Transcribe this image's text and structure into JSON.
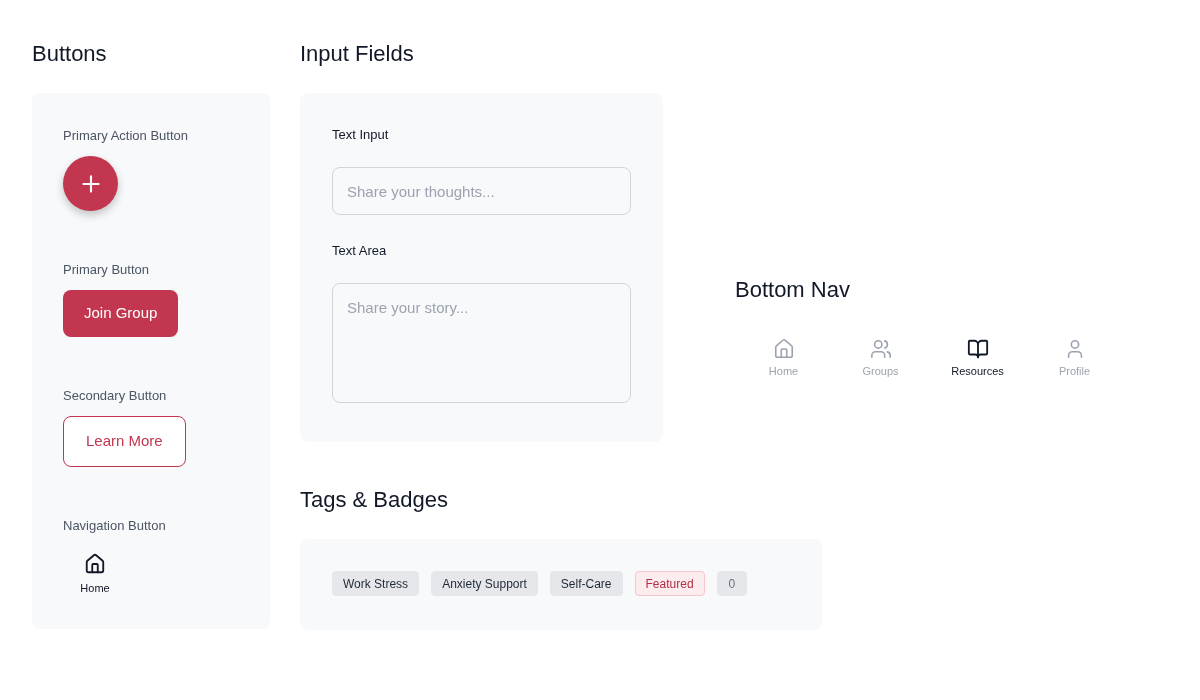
{
  "buttons": {
    "title": "Buttons",
    "items": [
      {
        "kind": "fab",
        "label": "Primary Action Button"
      },
      {
        "kind": "primary",
        "label": "Primary Button",
        "text": "Join Group"
      },
      {
        "kind": "secondary",
        "label": "Secondary Button",
        "text": "Learn More"
      },
      {
        "kind": "nav",
        "label": "Navigation Button",
        "text": "Home"
      }
    ]
  },
  "input_fields": {
    "title": "Input Fields",
    "fields": [
      {
        "kind": "input",
        "label": "Text Input",
        "placeholder": "Share your thoughts..."
      },
      {
        "kind": "textarea",
        "label": "Text Area",
        "placeholder": "Share your story..."
      }
    ]
  },
  "bottom_nav": {
    "title": "Bottom Nav",
    "items": [
      {
        "label": "Home",
        "selected": false
      },
      {
        "label": "Groups",
        "selected": false
      },
      {
        "label": "Resources",
        "selected": true
      },
      {
        "label": "Profile",
        "selected": false
      }
    ]
  },
  "tags_badges": {
    "title": "Tags & Badges",
    "items": [
      {
        "kind": "tag",
        "text": "Work Stress"
      },
      {
        "kind": "tag",
        "text": "Anxiety Support"
      },
      {
        "kind": "tag",
        "text": "Self-Care"
      },
      {
        "kind": "featured",
        "text": "Featured"
      },
      {
        "kind": "count",
        "text": "0"
      }
    ]
  }
}
